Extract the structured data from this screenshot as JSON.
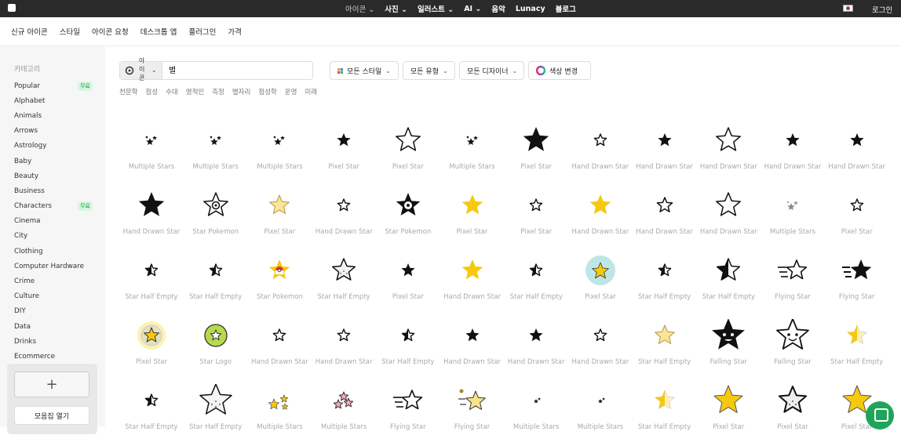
{
  "topbar": {
    "nav": [
      {
        "label": "아이콘",
        "chev": true,
        "bold": false
      },
      {
        "label": "사진",
        "chev": true,
        "bold": true
      },
      {
        "label": "일러스트",
        "chev": true,
        "bold": true
      },
      {
        "label": "AI",
        "chev": true,
        "bold": true
      },
      {
        "label": "음악",
        "chev": false,
        "bold": true
      },
      {
        "label": "Lunacy",
        "chev": false,
        "bold": true
      },
      {
        "label": "블로그",
        "chev": false,
        "bold": true
      }
    ],
    "login": "로그인"
  },
  "subnav": [
    "신규 아이콘",
    "스타일",
    "아이콘 요청",
    "데스크톱 앱",
    "플러그인",
    "가격"
  ],
  "sidebar": {
    "title": "카테고리",
    "free_badge": "무료",
    "categories": [
      {
        "label": "Popular",
        "free": true
      },
      {
        "label": "Alphabet",
        "free": false
      },
      {
        "label": "Animals",
        "free": false
      },
      {
        "label": "Arrows",
        "free": false
      },
      {
        "label": "Astrology",
        "free": false
      },
      {
        "label": "Baby",
        "free": false
      },
      {
        "label": "Beauty",
        "free": false
      },
      {
        "label": "Business",
        "free": false
      },
      {
        "label": "Characters",
        "free": true
      },
      {
        "label": "Cinema",
        "free": false
      },
      {
        "label": "City",
        "free": false
      },
      {
        "label": "Clothing",
        "free": false
      },
      {
        "label": "Computer Hardware",
        "free": false
      },
      {
        "label": "Crime",
        "free": false
      },
      {
        "label": "Culture",
        "free": false
      },
      {
        "label": "DIY",
        "free": false
      },
      {
        "label": "Data",
        "free": false
      },
      {
        "label": "Drinks",
        "free": false
      },
      {
        "label": "Ecommerce",
        "free": false
      }
    ],
    "add_label": "+",
    "open_collection": "모음집 열기"
  },
  "search": {
    "type_label": "아이콘",
    "value": "별"
  },
  "filters": {
    "style": "모든 스타일",
    "type": "모든 유형",
    "designer": "모든 디자이너",
    "color": "색상 변경"
  },
  "tags": [
    "천문학",
    "점성",
    "수대",
    "영적인",
    "측정",
    "별자리",
    "점성학",
    "운명",
    "미래"
  ],
  "icons": [
    [
      "Multiple Stars",
      "Multiple Stars",
      "Multiple Stars",
      "Pixel Star",
      "Pixel Star",
      "Multiple Stars",
      "Pixel Star",
      "Hand Drawn Star",
      "Hand Drawn Star",
      "Hand Drawn Star",
      "Hand Drawn Star",
      "Hand Drawn Star"
    ],
    [
      "Hand Drawn Star",
      "Star Pokemon",
      "Pixel Star",
      "Hand Drawn Star",
      "Star Pokemon",
      "Pixel Star",
      "Pixel Star",
      "Hand Drawn Star",
      "Hand Drawn Star",
      "Hand Drawn Star",
      "Multiple Stars",
      "Pixel Star"
    ],
    [
      "Star Half Empty",
      "Star Half Empty",
      "Star Pokemon",
      "Star Half Empty",
      "Pixel Star",
      "Hand Drawn Star",
      "Star Half Empty",
      "Pixel Star",
      "Star Half Empty",
      "Star Half Empty",
      "Flying Star",
      "Flying Star"
    ],
    [
      "Pixel Star",
      "Star Logo",
      "Hand Drawn Star",
      "Hand Drawn Star",
      "Star Half Empty",
      "Hand Drawn Star",
      "Hand Drawn Star",
      "Hand Drawn Star",
      "Star Half Empty",
      "Falling Star",
      "Falling Star",
      "Star Half Empty"
    ],
    [
      "Star Half Empty",
      "Star Half Empty",
      "Multiple Stars",
      "Multiple Stars",
      "Flying Star",
      "Flying Star",
      "Multiple Stars",
      "Multiple Stars",
      "Star Half Empty",
      "Pixel Star",
      "Pixel Star",
      "Pixel Star"
    ]
  ],
  "icon_kinds": [
    [
      "multi",
      "multi",
      "multi",
      "solid-s",
      "outline-l",
      "multi",
      "solid-l",
      "outline-s",
      "solid-s",
      "outline-l",
      "solid-s",
      "solid-s"
    ],
    [
      "solid-l",
      "poke-outline",
      "yellow-outline",
      "outline-s",
      "poke-solid",
      "yellow",
      "outline-s",
      "yellow",
      "outline-m",
      "outline-l",
      "multi-grey",
      "outline-s"
    ],
    [
      "half-s",
      "half-s",
      "poke-yellow",
      "dotted",
      "solid-s",
      "yellow",
      "half-s",
      "yellow-bubble",
      "half-s",
      "half-l",
      "flying-outline",
      "flying-solid"
    ],
    [
      "yellow-circle",
      "green-circle",
      "outline-s",
      "outline-s",
      "half-s",
      "solid-s",
      "solid-s",
      "outline-s",
      "yellow-outline",
      "face-solid",
      "face-outline",
      "yellow-half"
    ],
    [
      "half-s",
      "dotted-l",
      "multi-yellow",
      "multi-red",
      "flying-outline",
      "flying-yellow",
      "multi-s",
      "multi-s",
      "yellow-half",
      "yellow-pixel",
      "pixel-dots",
      "yellow-pixel"
    ]
  ],
  "colors": {
    "accent_green": "#1fa55a",
    "star_yellow": "#f6c90e",
    "topbar": "#2a2a2a"
  }
}
